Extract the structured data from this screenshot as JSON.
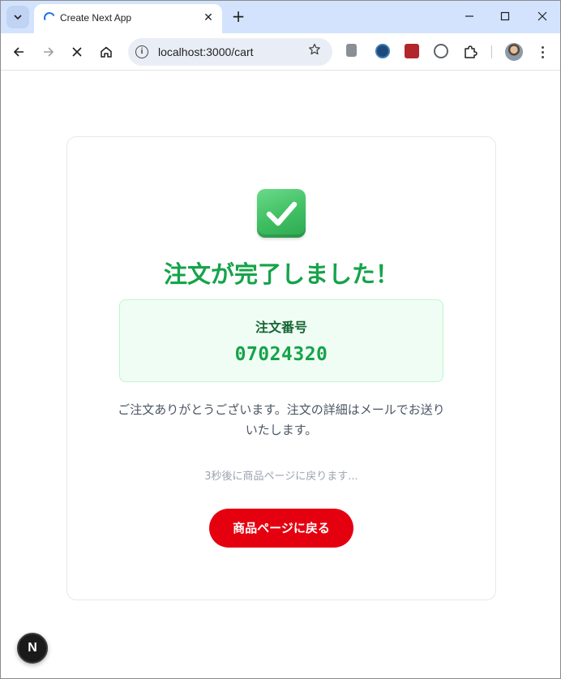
{
  "browser": {
    "tab": {
      "title": "Create Next App",
      "close_glyph": "✕",
      "loading": true
    },
    "new_tab_glyph": "+",
    "address": {
      "url": "localhost:3000/cart"
    },
    "icons": {
      "tab_search": "chevron-down-icon",
      "back": "arrow-left-icon",
      "forward": "arrow-right-icon",
      "stop": "close-icon",
      "home": "home-icon",
      "info": "info-icon",
      "bookmark": "star-icon",
      "extensions": "puzzle-icon",
      "menu": "kebab-menu-icon"
    },
    "accent_color": "#d3e3fd"
  },
  "order_complete": {
    "title": "注文が完了しました！",
    "order_label": "注文番号",
    "order_number": "07024320",
    "thanks_message": "ご注文ありがとうございます。注文の詳細はメールでお送りいたします。",
    "redirect_note": "3秒後に商品ページに戻ります...",
    "back_button_label": "商品ページに戻る",
    "colors": {
      "success": "#16a34a",
      "button": "#e50010",
      "box_bg": "#f0fdf4"
    }
  },
  "dev_badge": {
    "label": "N"
  }
}
